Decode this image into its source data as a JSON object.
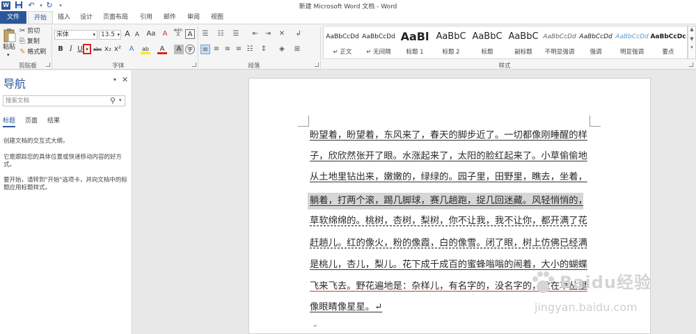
{
  "window": {
    "title": "新建 Microsoft Word 文档 - Word",
    "app_icon": "W"
  },
  "quick_access": {
    "save": "save-icon",
    "undo": "↶",
    "redo": "↻"
  },
  "tabs": [
    "文件",
    "开始",
    "插入",
    "设计",
    "页面布局",
    "引用",
    "邮件",
    "审阅",
    "视图"
  ],
  "ribbon": {
    "clipboard": {
      "paste": "粘贴",
      "cut": "剪切",
      "copy": "复制",
      "format_painter": "格式刷",
      "label": "剪贴板"
    },
    "font": {
      "name": "宋体",
      "size": "13.5",
      "grow": "A",
      "shrink": "A",
      "case": "Aa",
      "clear": "A",
      "phonetic": "wén",
      "border": "A",
      "bold": "B",
      "italic": "I",
      "underline": "U",
      "strike": "abc",
      "sub": "x₂",
      "sup": "x²",
      "effects": "A",
      "highlight": "ab",
      "color": "A",
      "shade": "A",
      "enclose": "字",
      "label": "字体"
    },
    "paragraph": {
      "label": "段落"
    },
    "styles": {
      "label": "样式",
      "items": [
        {
          "preview": "AaBbCcDd",
          "name": "↵ 正文"
        },
        {
          "preview": "AaBbCcDd",
          "name": "↵ 无间隔"
        },
        {
          "preview": "AaBl",
          "name": "标题 1"
        },
        {
          "preview": "AaBbC",
          "name": "标题 2"
        },
        {
          "preview": "AaBbC",
          "name": "标题"
        },
        {
          "preview": "AaBbC",
          "name": "副标题"
        },
        {
          "preview": "AaBbCcDd",
          "name": "不明显强调"
        },
        {
          "preview": "AaBbCcDd",
          "name": "强调"
        },
        {
          "preview": "AaBbCcDd",
          "name": "明显强调"
        },
        {
          "preview": "AaBbCcDc",
          "name": "要点"
        }
      ]
    }
  },
  "nav": {
    "title": "导航",
    "search_placeholder": "搜索文档",
    "tabs": [
      "标题",
      "页面",
      "结果"
    ],
    "msg1": "创建文档的交互式大纲。",
    "msg2": "它是跟踪您的具体位置或快速移动内容的好方式。",
    "msg3": "要开始，请转到\"开始\"选项卡，并向文档中的标题应用标题样式。"
  },
  "document": {
    "lines": [
      "盼望着，盼望着，东风来了，春天的脚步近了。一切都像刚睡醒的样",
      "子，欣欣然张开了眼。水涨起来了，太阳的脸红起来了。小草偷偷地",
      "从土地里钻出来，嫩嫩的，绿绿的。园子里，田野里，瞧去，坐着，",
      "躺着，打两个滚，踢几脚球，赛几趟跑，捉几回迷藏。风轻悄悄的，",
      "草软绵绵的。桃树，杏树，梨树，你不让我，我不让你，都开满了花",
      "赶趟儿。红的像火，粉的像霞，白的像雪。闭了眼，树上仿佛已经满",
      "是桃儿，杏儿，梨儿。花下成千成百的蜜蜂嗡嗡的闹着，大小的蝴蝶",
      "飞来飞去。野花遍地是：杂样儿，有名字的，没名字的，散在草丛里",
      "像眼睛像星星。↵"
    ]
  },
  "watermark": {
    "text": "Baidu经验",
    "url": "jingyan.baidu.com"
  },
  "colors": {
    "accent": "#2b579a",
    "highlight_red": "#e0201c"
  }
}
